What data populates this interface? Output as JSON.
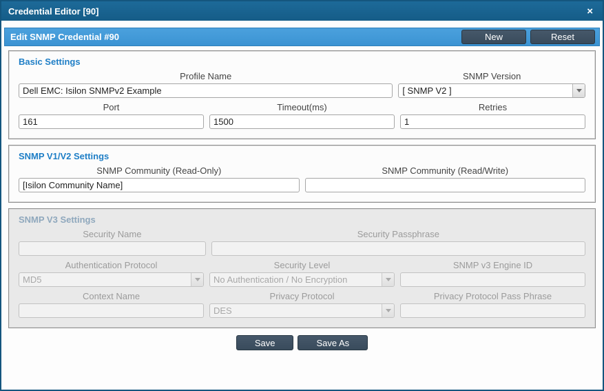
{
  "window": {
    "title": "Credential Editor [90]",
    "close_glyph": "×"
  },
  "header": {
    "title": "Edit SNMP Credential #90",
    "new_button": "New",
    "reset_button": "Reset"
  },
  "basic_settings": {
    "title": "Basic Settings",
    "profile_name": {
      "label": "Profile Name",
      "value": "Dell EMC: Isilon SNMPv2 Example"
    },
    "snmp_version": {
      "label": "SNMP Version",
      "value": "[ SNMP V2 ]"
    },
    "port": {
      "label": "Port",
      "value": "161"
    },
    "timeout": {
      "label": "Timeout(ms)",
      "value": "1500"
    },
    "retries": {
      "label": "Retries",
      "value": "1"
    }
  },
  "v1v2_settings": {
    "title": "SNMP V1/V2 Settings",
    "community_ro": {
      "label": "SNMP Community (Read-Only)",
      "value": "[Isilon Community Name]"
    },
    "community_rw": {
      "label": "SNMP Community (Read/Write)",
      "value": ""
    }
  },
  "v3_settings": {
    "title": "SNMP V3 Settings",
    "security_name": {
      "label": "Security Name",
      "value": ""
    },
    "security_passphrase": {
      "label": "Security Passphrase",
      "value": ""
    },
    "auth_protocol": {
      "label": "Authentication Protocol",
      "value": "MD5"
    },
    "security_level": {
      "label": "Security Level",
      "value": "No Authentication / No Encryption"
    },
    "engine_id": {
      "label": "SNMP v3 Engine ID",
      "value": ""
    },
    "context_name": {
      "label": "Context Name",
      "value": ""
    },
    "privacy_protocol": {
      "label": "Privacy Protocol",
      "value": "DES"
    },
    "privacy_passphrase": {
      "label": "Privacy Protocol Pass Phrase",
      "value": ""
    }
  },
  "footer": {
    "save_button": "Save",
    "save_as_button": "Save As"
  },
  "colors": {
    "titlebar": "#155c87",
    "header_bar": "#3b93d3",
    "button": "#394b5c",
    "section_title": "#1e7ec6"
  }
}
